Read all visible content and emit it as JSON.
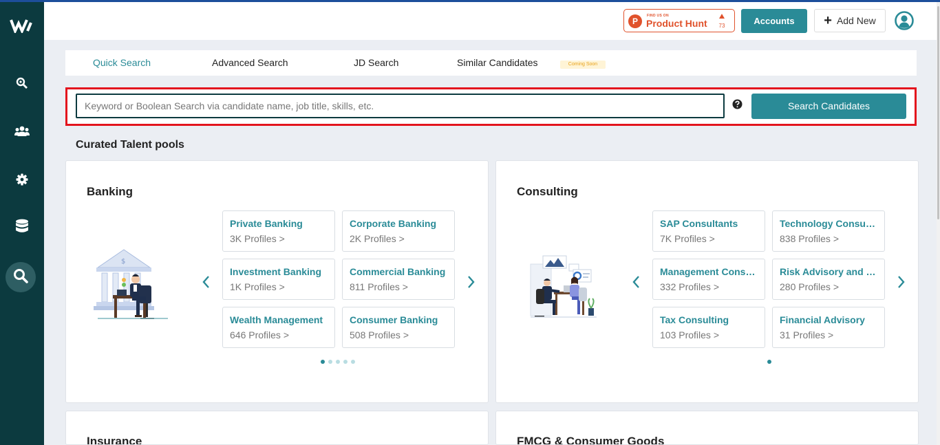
{
  "header": {
    "product_hunt": {
      "small": "FIND US ON",
      "name": "Product Hunt",
      "count": "73"
    },
    "accounts_label": "Accounts",
    "add_new_label": "Add New"
  },
  "sidebar": {
    "items": [
      {
        "icon": "search-key-icon"
      },
      {
        "icon": "users-icon"
      },
      {
        "icon": "gear-icon"
      },
      {
        "icon": "database-icon"
      },
      {
        "icon": "search-icon",
        "active": true
      }
    ]
  },
  "tabs": [
    {
      "label": "Quick Search",
      "active": true
    },
    {
      "label": "Advanced Search"
    },
    {
      "label": "JD Search"
    },
    {
      "label": "Similar Candidates"
    }
  ],
  "coming_soon": "Coming Soon",
  "search": {
    "placeholder": "Keyword or Boolean Search via candidate name, job title, skills, etc.",
    "button": "Search Candidates"
  },
  "section_title": "Curated Talent pools",
  "cards": [
    {
      "title": "Banking",
      "pools": [
        {
          "name": "Private Banking",
          "count": "3K Profiles >"
        },
        {
          "name": "Corporate Banking",
          "count": "2K Profiles >"
        },
        {
          "name": "Investment Banking",
          "count": "1K Profiles >"
        },
        {
          "name": "Commercial Banking",
          "count": "811 Profiles >"
        },
        {
          "name": "Wealth Management",
          "count": "646 Profiles >"
        },
        {
          "name": "Consumer Banking",
          "count": "508 Profiles >"
        }
      ],
      "dots": 5,
      "active_dot": 0
    },
    {
      "title": "Consulting",
      "pools": [
        {
          "name": "SAP Consultants",
          "count": "7K Profiles >"
        },
        {
          "name": "Technology Consulting",
          "count": "838 Profiles >"
        },
        {
          "name": "Management Consulting",
          "count": "332 Profiles >"
        },
        {
          "name": "Risk Advisory and Consulting",
          "count": "280 Profiles >"
        },
        {
          "name": "Tax Consulting",
          "count": "103 Profiles >"
        },
        {
          "name": "Financial Advisory",
          "count": "31 Profiles >"
        }
      ],
      "dots": 1,
      "active_dot": 0
    },
    {
      "title": "Insurance"
    },
    {
      "title": "FMCG & Consumer Goods"
    }
  ],
  "colors": {
    "sidebar": "#0c3a3f",
    "accent": "#2a8b97",
    "highlight_border": "#e3141d",
    "product_hunt": "#e0522c"
  }
}
